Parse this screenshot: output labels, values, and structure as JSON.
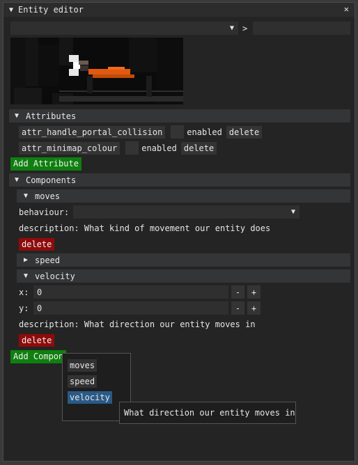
{
  "window": {
    "title": "Entity editor",
    "close_glyph": "✕"
  },
  "top_combo": {
    "selected": "",
    "arrow": "▼",
    "separator": ">",
    "text_value": ""
  },
  "sections": {
    "attributes": {
      "label": "Attributes",
      "items": [
        {
          "name": "attr_handle_portal_collision",
          "enabled_label": "enabled",
          "delete_label": "delete"
        },
        {
          "name": "attr_minimap_colour",
          "enabled_label": "enabled",
          "delete_label": "delete"
        }
      ],
      "add_label": "Add Attribute"
    },
    "components": {
      "label": "Components",
      "moves": {
        "label": "moves",
        "behaviour_label": "behaviour:",
        "behaviour_value": "",
        "description": "description: What kind of movement our entity does",
        "delete_label": "delete"
      },
      "speed": {
        "label": "speed"
      },
      "velocity": {
        "label": "velocity",
        "x_label": "x:",
        "x_value": "0",
        "y_label": "y:",
        "y_value": "0",
        "minus": "-",
        "plus": "+",
        "description": "description: What direction our entity moves in",
        "delete_label": "delete"
      },
      "add_label": "Add Compon"
    }
  },
  "popup": {
    "items": [
      "moves",
      "speed",
      "velocity"
    ],
    "tooltip": "What direction our entity moves in"
  },
  "colors": {
    "green": "#0f7f0f",
    "red": "#8f0b0b",
    "highlight": "#2a5a86"
  }
}
